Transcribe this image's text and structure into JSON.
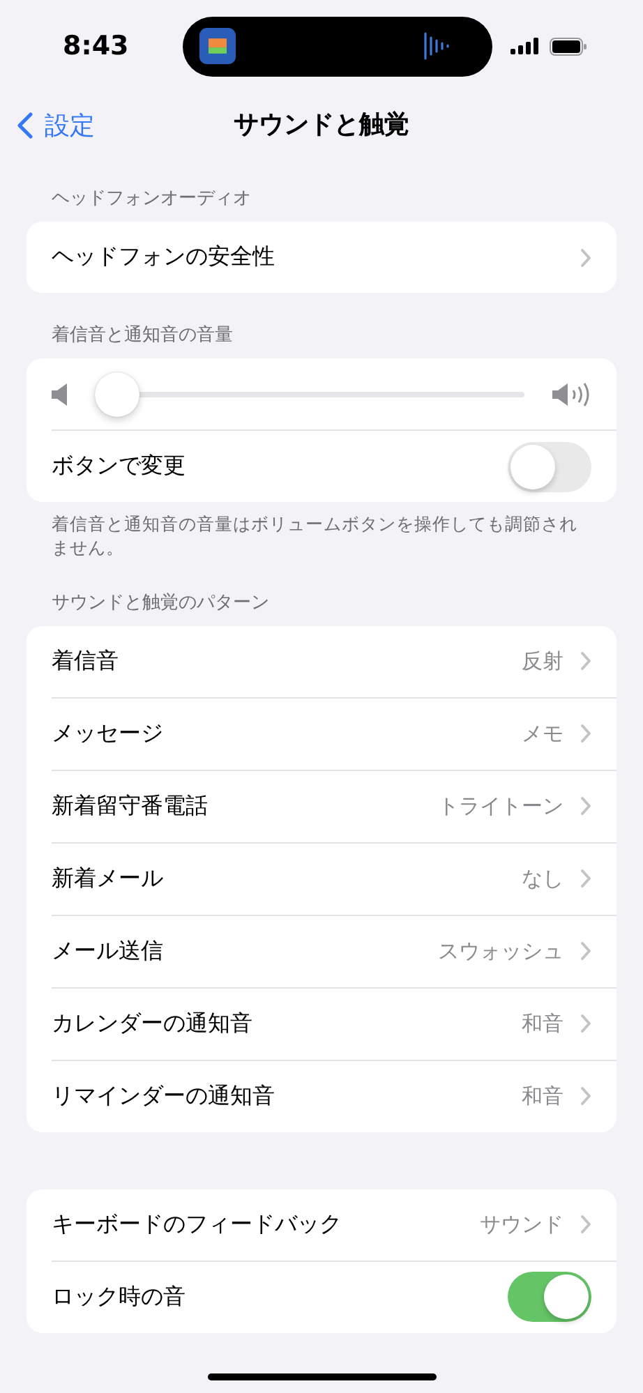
{
  "status_bar": {
    "time": "8:43"
  },
  "nav": {
    "back": "設定",
    "title": "サウンドと触覚"
  },
  "sections": [
    {
      "header": "ヘッドフォンオーディオ",
      "rows": [
        {
          "kind": "link",
          "label": "ヘッドフォンの安全性"
        }
      ]
    },
    {
      "header": "着信音と通知音の音量",
      "rows": [
        {
          "kind": "slider",
          "level": 0.05
        },
        {
          "kind": "toggle",
          "label": "ボタンで変更",
          "on": false
        }
      ],
      "footer": "着信音と通知音の音量はボリュームボタンを操作しても調節されません。"
    },
    {
      "header": "サウンドと触覚のパターン",
      "rows": [
        {
          "kind": "link",
          "label": "着信音",
          "value": "反射"
        },
        {
          "kind": "link",
          "label": "メッセージ",
          "value": "メモ"
        },
        {
          "kind": "link",
          "label": "新着留守番電話",
          "value": "トライトーン"
        },
        {
          "kind": "link",
          "label": "新着メール",
          "value": "なし"
        },
        {
          "kind": "link",
          "label": "メール送信",
          "value": "スウォッシュ"
        },
        {
          "kind": "link",
          "label": "カレンダーの通知音",
          "value": "和音"
        },
        {
          "kind": "link",
          "label": "リマインダーの通知音",
          "value": "和音"
        }
      ]
    },
    {
      "rows": [
        {
          "kind": "link",
          "label": "キーボードのフィードバック",
          "value": "サウンド"
        },
        {
          "kind": "toggle",
          "label": "ロック時の音",
          "on": true
        }
      ]
    }
  ]
}
